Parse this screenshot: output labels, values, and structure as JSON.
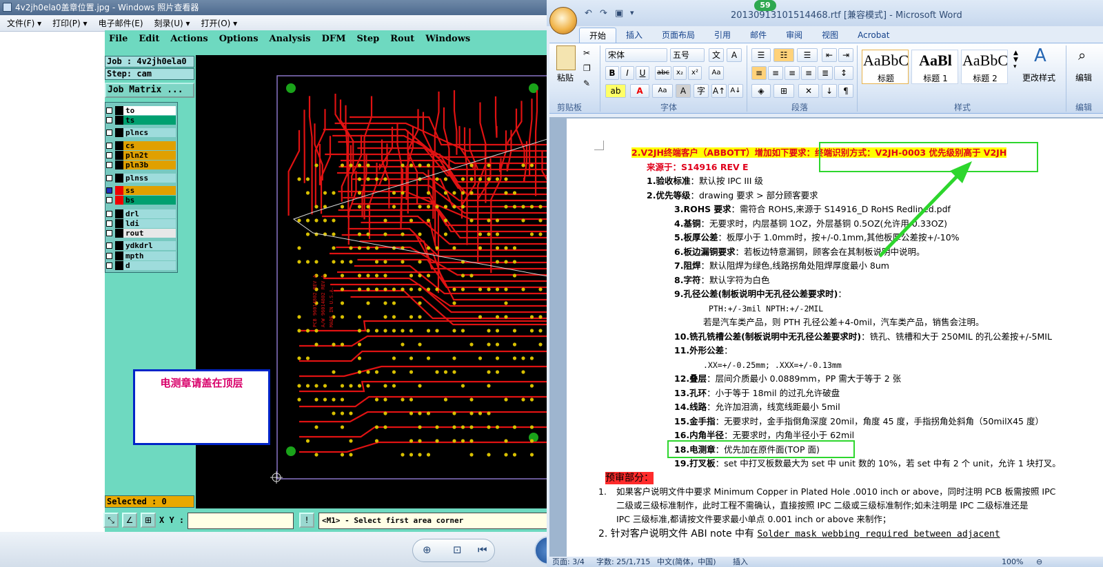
{
  "viewer": {
    "title": "4v2jh0ela0盖章位置.jpg - Windows 照片查看器",
    "menu": [
      "文件(F) ▾",
      "打印(P) ▾",
      "电子邮件(E)",
      "刻录(U) ▾",
      "打开(O) ▾"
    ]
  },
  "cam": {
    "menu": [
      "File",
      "Edit",
      "Actions",
      "Options",
      "Analysis",
      "DFM",
      "Step",
      "Rout",
      "Windows"
    ],
    "job": "Job : 4v2jh0ela0",
    "step": "Step: cam",
    "matrix_button": "Job Matrix ...",
    "layers": [
      {
        "name": "to",
        "color": "#ffffff"
      },
      {
        "name": "ts",
        "color": "#00a070"
      },
      {
        "name": "plncs",
        "color": "#9edcdc"
      },
      {
        "name": "cs",
        "color": "#e0a000"
      },
      {
        "name": "pln2t",
        "color": "#e0a000"
      },
      {
        "name": "pln3b",
        "color": "#e0a000"
      },
      {
        "name": "plnss",
        "color": "#9edcdc"
      },
      {
        "name": "ss",
        "color": "#e0a000"
      },
      {
        "name": "bs",
        "color": "#00a070"
      },
      {
        "name": "drl",
        "color": "#9edcdc"
      },
      {
        "name": "ldi",
        "color": "#9edcdc"
      },
      {
        "name": "rout",
        "color": "#e8e8e8"
      },
      {
        "name": "ydkdrl",
        "color": "#9edcdc"
      },
      {
        "name": "mpth",
        "color": "#9edcdc"
      },
      {
        "name": "d",
        "color": "#9edcdc"
      }
    ],
    "selected": "Selected : 0",
    "xy_label": "X Y :",
    "prompt": "<M1> - Select first area corner",
    "stamp_note": "电测章请盖在顶层",
    "pcb_text": [
      "PCB 96014802 REV A",
      "A/W 96014802 REV A",
      "MADE IN U.S.A."
    ]
  },
  "word": {
    "title": "20130913101514468.rtf [兼容模式] - Microsoft Word",
    "badge": "59",
    "tabs": [
      "开始",
      "插入",
      "页面布局",
      "引用",
      "邮件",
      "审阅",
      "视图",
      "Acrobat"
    ],
    "font_name": "宋体",
    "font_size": "五号",
    "paste_label": "粘贴",
    "groups": [
      "剪贴板",
      "字体",
      "段落",
      "样式",
      "编辑"
    ],
    "styles": [
      {
        "preview": "AaBbC",
        "caption": "标题"
      },
      {
        "preview": "AaBl",
        "caption": "标题 1"
      },
      {
        "preview": "AaBbC",
        "caption": "标题 2"
      }
    ],
    "change_styles": "更改样式",
    "edit_label": "编辑",
    "status": {
      "page": "页面: 3/4",
      "words": "字数: 25/1,715",
      "lang": "中文(简体，中国)",
      "mode": "插入",
      "zoom": "100%"
    }
  },
  "doc": {
    "l1": "2.V2JH终端客户（ABBOTT）增加如下要求：终端识别方式：V2JH-0003  优先级别高于 V2JH",
    "l2": "来源于：S14916 REV E",
    "l3a": "1.验收标准",
    "l3b": "：默认按 IPC III 级",
    "l4a": "2.优先等级",
    "l4b": "：drawing 要求 > 部分顾客要求",
    "l5a": "3.ROHS 要求",
    "l5b": "：需符合 ROHS,来源于 S14916_D RoHS Redlined.pdf",
    "l6a": "4.基铜",
    "l6b": "：无要求时，内层基铜 1OZ，外层基铜 0.5OZ(允许用 0.33OZ)",
    "l7a": "5.板厚公差",
    "l7b": "：板厚小于 1.0mm时，按+/-0.1mm,其他板厚公差按+/-10%",
    "l8a": "6.板边漏铜要求",
    "l8b": "：若板边特意漏铜，顾客会在其制板说明中说明。",
    "l9a": "7.阻焊",
    "l9b": "：默认阻焊为绿色,线路拐角处阻焊厚度最小 8um",
    "l10a": "8.字符",
    "l10b": "：默认字符为白色",
    "l11a": "9.孔径公差(制板说明中无孔径公差要求时)",
    "l11b": "：",
    "l12": "PTH:+/-3mil   NPTH:+/-2MIL",
    "l13": "若是汽车类产品，则 PTH 孔径公差+4-0mil，汽车类产品，销售会注明。",
    "l14a": "10.铣孔铣槽公差(制板说明中无孔径公差要求时)",
    "l14b": "：铣孔、铣槽和大于 250MIL 的孔公差按+/-5MIL",
    "l15a": "11.外形公差",
    "l15b": "：",
    "l16": ".XX=+/-0.25mm; .XXX=+/-0.13mm",
    "l17a": "12.叠层",
    "l17b": "：层间介质最小 0.0889mm，PP 需大于等于 2 张",
    "l18a": "13.孔环",
    "l18b": "：小于等于 18mil 的过孔允许破盘",
    "l19a": "14.线路",
    "l19b": "：允许加泪滴，线宽线距最小 5mil",
    "l20a": "15.金手指",
    "l20b": "：无要求时，金手指倒角深度 20mil，角度 45 度，手指拐角处斜角（50milX45 度）",
    "l21a": "16.内角半径",
    "l21b": "：无要求时，内角半径小于 62mil",
    "l22a": "18.电测章",
    "l22b": "：优先加在原件面(TOP 面)",
    "l23a": "19.打叉板",
    "l23b": "：set 中打叉板数最大为 set 中 unit 数的 10%，若 set 中有 2 个 unit，允许 1 块打叉。",
    "l24": "预审部分：",
    "l25": "1.",
    "l25b": "如果客户说明文件中要求 Minimum Copper in Plated Hole .0010 inch or above，同时注明 PCB 板需按照 IPC",
    "l26": "二级或三级标准制作，此时工程不需确认，直接按照 IPC 二级或三级标准制作;如未注明是 IPC 二级标准还是",
    "l27": "IPC 三级标准,都请按文件要求最小单点 0.001 inch or above 来制作；",
    "l28a": "2. 针对客户说明文件 ABI note 中有 ",
    "l28b": "Solder mask webbing required between adjacent"
  }
}
